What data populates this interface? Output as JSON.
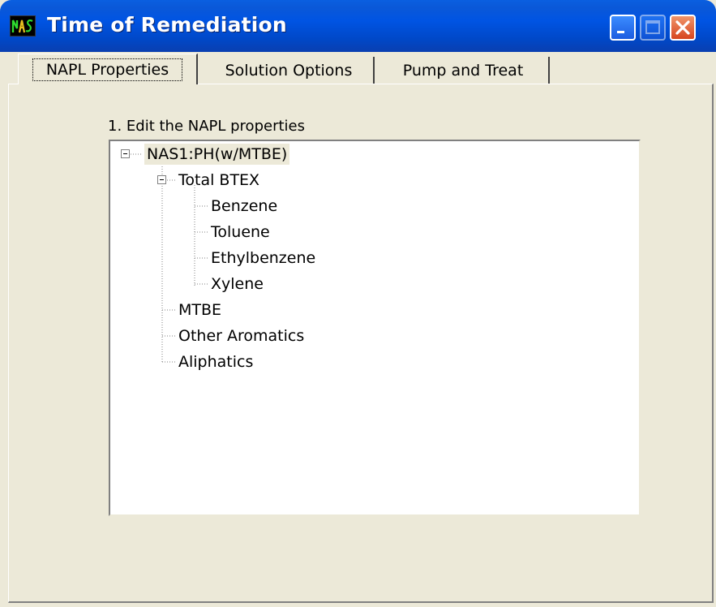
{
  "window": {
    "title": "Time of Remediation",
    "app_icon_text": "NAS",
    "controls": {
      "minimize": "minimize",
      "maximize": "maximize",
      "close": "close"
    }
  },
  "tabs": [
    {
      "label": "NAPL Properties",
      "active": true
    },
    {
      "label": "Solution Options",
      "active": false
    },
    {
      "label": "Pump and Treat",
      "active": false
    }
  ],
  "napl_panel": {
    "instruction": "1. Edit the NAPL properties",
    "tree": {
      "root": "NAS1:PH(w/MTBE)",
      "group": "Total BTEX",
      "btex_children": [
        "Benzene",
        "Toluene",
        "Ethylbenzene",
        "Xylene"
      ],
      "siblings": [
        "MTBE",
        "Other Aromatics",
        "Aliphatics"
      ]
    }
  }
}
